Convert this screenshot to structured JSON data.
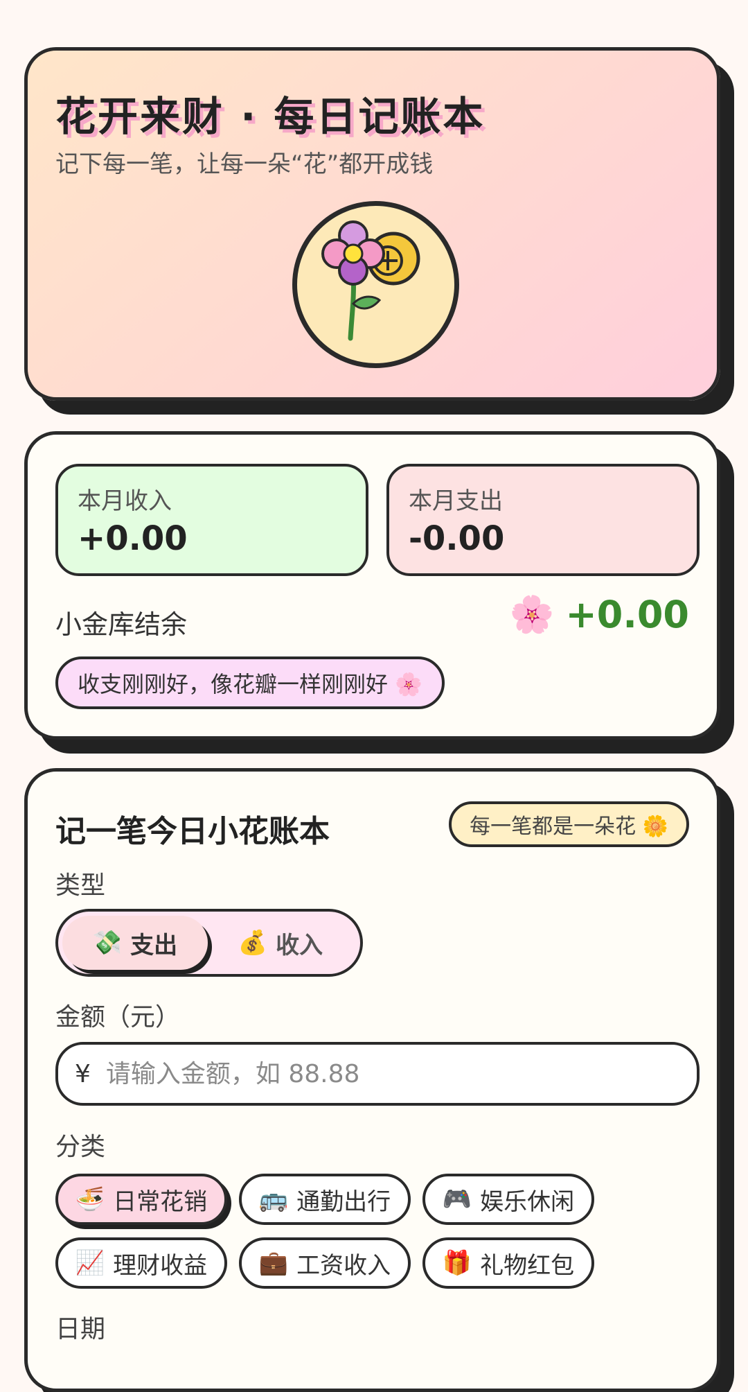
{
  "header": {
    "title": "花开来财 · 每日记账本",
    "subtitle": "记下每一笔，让每一朵“花”都开成钱",
    "logo_icon": "flower-coin-icon"
  },
  "summary": {
    "income_label": "本月收入",
    "income_value": "+0.00",
    "expense_label": "本月支出",
    "expense_value": "-0.00",
    "balance_label": "小金库结余",
    "balance_icon": "🌸",
    "balance_value": "+0.00",
    "note": "收支刚刚好，像花瓣一样刚刚好 🌸"
  },
  "form": {
    "title": "记一笔今日小花账本",
    "badge": "每一笔都是一朵花 🌼",
    "type_label": "类型",
    "type_options": [
      {
        "icon": "💸",
        "label": "支出",
        "selected": true
      },
      {
        "icon": "💰",
        "label": "收入",
        "selected": false
      }
    ],
    "amount_label": "金额（元）",
    "amount_prefix": "¥",
    "amount_placeholder": "请输入金额，如 88.88",
    "amount_value": "",
    "category_label": "分类",
    "categories": [
      {
        "icon": "🍜",
        "label": "日常花销",
        "selected": true
      },
      {
        "icon": "🚌",
        "label": "通勤出行",
        "selected": false
      },
      {
        "icon": "🎮",
        "label": "娱乐休闲",
        "selected": false
      },
      {
        "icon": "📈",
        "label": "理财收益",
        "selected": false
      },
      {
        "icon": "💼",
        "label": "工资收入",
        "selected": false
      },
      {
        "icon": "🎁",
        "label": "礼物红包",
        "selected": false
      }
    ],
    "date_label": "日期"
  },
  "colors": {
    "background": "#fff8f4",
    "income_box": "#e3fde0",
    "expense_box": "#fde2e2",
    "balance_positive": "#3a8a2e",
    "note_bg": "#fcdcf8",
    "badge_bg": "#fff0c6",
    "selected_chip": "#fdd7e3",
    "outline": "#2a2a2a"
  }
}
